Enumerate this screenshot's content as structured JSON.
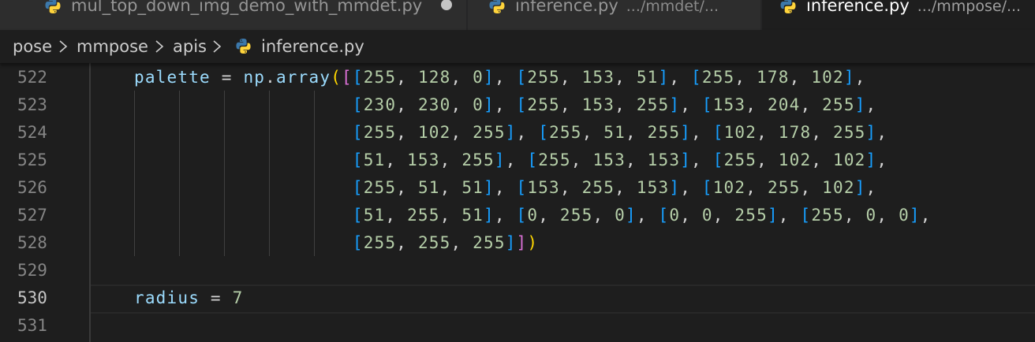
{
  "tabs": [
    {
      "label": "mul_top_down_img_demo_with_mmdet.py",
      "description": "",
      "modified": true,
      "active": false
    },
    {
      "label": "inference.py",
      "description": ".../mmdet/...",
      "modified": false,
      "active": false
    },
    {
      "label": "inference.py",
      "description": ".../mmpose/...",
      "modified": false,
      "active": true
    }
  ],
  "breadcrumb": {
    "items": [
      "pose",
      "mmpose",
      "apis",
      "inference.py"
    ],
    "file_icon": "python-file-icon"
  },
  "editor": {
    "active_line": "530",
    "lines": [
      {
        "number": "522",
        "tokens": [
          [
            "v",
            "palette"
          ],
          [
            "p",
            " = "
          ],
          [
            "v",
            "np"
          ],
          [
            "p",
            "."
          ],
          [
            "v",
            "array"
          ],
          [
            "b1",
            "("
          ],
          [
            "b2",
            "["
          ],
          [
            "b3",
            "["
          ],
          [
            "n",
            "255"
          ],
          [
            "p",
            ", "
          ],
          [
            "n",
            "128"
          ],
          [
            "p",
            ", "
          ],
          [
            "n",
            "0"
          ],
          [
            "b3",
            "]"
          ],
          [
            "p",
            ", "
          ],
          [
            "b3",
            "["
          ],
          [
            "n",
            "255"
          ],
          [
            "p",
            ", "
          ],
          [
            "n",
            "153"
          ],
          [
            "p",
            ", "
          ],
          [
            "n",
            "51"
          ],
          [
            "b3",
            "]"
          ],
          [
            "p",
            ", "
          ],
          [
            "b3",
            "["
          ],
          [
            "n",
            "255"
          ],
          [
            "p",
            ", "
          ],
          [
            "n",
            "178"
          ],
          [
            "p",
            ", "
          ],
          [
            "n",
            "102"
          ],
          [
            "b3",
            "]"
          ],
          [
            "p",
            ","
          ]
        ]
      },
      {
        "number": "523",
        "tokens": [
          [
            "p",
            "                    "
          ],
          [
            "b3",
            "["
          ],
          [
            "n",
            "230"
          ],
          [
            "p",
            ", "
          ],
          [
            "n",
            "230"
          ],
          [
            "p",
            ", "
          ],
          [
            "n",
            "0"
          ],
          [
            "b3",
            "]"
          ],
          [
            "p",
            ", "
          ],
          [
            "b3",
            "["
          ],
          [
            "n",
            "255"
          ],
          [
            "p",
            ", "
          ],
          [
            "n",
            "153"
          ],
          [
            "p",
            ", "
          ],
          [
            "n",
            "255"
          ],
          [
            "b3",
            "]"
          ],
          [
            "p",
            ", "
          ],
          [
            "b3",
            "["
          ],
          [
            "n",
            "153"
          ],
          [
            "p",
            ", "
          ],
          [
            "n",
            "204"
          ],
          [
            "p",
            ", "
          ],
          [
            "n",
            "255"
          ],
          [
            "b3",
            "]"
          ],
          [
            "p",
            ","
          ]
        ]
      },
      {
        "number": "524",
        "tokens": [
          [
            "p",
            "                    "
          ],
          [
            "b3",
            "["
          ],
          [
            "n",
            "255"
          ],
          [
            "p",
            ", "
          ],
          [
            "n",
            "102"
          ],
          [
            "p",
            ", "
          ],
          [
            "n",
            "255"
          ],
          [
            "b3",
            "]"
          ],
          [
            "p",
            ", "
          ],
          [
            "b3",
            "["
          ],
          [
            "n",
            "255"
          ],
          [
            "p",
            ", "
          ],
          [
            "n",
            "51"
          ],
          [
            "p",
            ", "
          ],
          [
            "n",
            "255"
          ],
          [
            "b3",
            "]"
          ],
          [
            "p",
            ", "
          ],
          [
            "b3",
            "["
          ],
          [
            "n",
            "102"
          ],
          [
            "p",
            ", "
          ],
          [
            "n",
            "178"
          ],
          [
            "p",
            ", "
          ],
          [
            "n",
            "255"
          ],
          [
            "b3",
            "]"
          ],
          [
            "p",
            ","
          ]
        ]
      },
      {
        "number": "525",
        "tokens": [
          [
            "p",
            "                    "
          ],
          [
            "b3",
            "["
          ],
          [
            "n",
            "51"
          ],
          [
            "p",
            ", "
          ],
          [
            "n",
            "153"
          ],
          [
            "p",
            ", "
          ],
          [
            "n",
            "255"
          ],
          [
            "b3",
            "]"
          ],
          [
            "p",
            ", "
          ],
          [
            "b3",
            "["
          ],
          [
            "n",
            "255"
          ],
          [
            "p",
            ", "
          ],
          [
            "n",
            "153"
          ],
          [
            "p",
            ", "
          ],
          [
            "n",
            "153"
          ],
          [
            "b3",
            "]"
          ],
          [
            "p",
            ", "
          ],
          [
            "b3",
            "["
          ],
          [
            "n",
            "255"
          ],
          [
            "p",
            ", "
          ],
          [
            "n",
            "102"
          ],
          [
            "p",
            ", "
          ],
          [
            "n",
            "102"
          ],
          [
            "b3",
            "]"
          ],
          [
            "p",
            ","
          ]
        ]
      },
      {
        "number": "526",
        "tokens": [
          [
            "p",
            "                    "
          ],
          [
            "b3",
            "["
          ],
          [
            "n",
            "255"
          ],
          [
            "p",
            ", "
          ],
          [
            "n",
            "51"
          ],
          [
            "p",
            ", "
          ],
          [
            "n",
            "51"
          ],
          [
            "b3",
            "]"
          ],
          [
            "p",
            ", "
          ],
          [
            "b3",
            "["
          ],
          [
            "n",
            "153"
          ],
          [
            "p",
            ", "
          ],
          [
            "n",
            "255"
          ],
          [
            "p",
            ", "
          ],
          [
            "n",
            "153"
          ],
          [
            "b3",
            "]"
          ],
          [
            "p",
            ", "
          ],
          [
            "b3",
            "["
          ],
          [
            "n",
            "102"
          ],
          [
            "p",
            ", "
          ],
          [
            "n",
            "255"
          ],
          [
            "p",
            ", "
          ],
          [
            "n",
            "102"
          ],
          [
            "b3",
            "]"
          ],
          [
            "p",
            ","
          ]
        ]
      },
      {
        "number": "527",
        "tokens": [
          [
            "p",
            "                    "
          ],
          [
            "b3",
            "["
          ],
          [
            "n",
            "51"
          ],
          [
            "p",
            ", "
          ],
          [
            "n",
            "255"
          ],
          [
            "p",
            ", "
          ],
          [
            "n",
            "51"
          ],
          [
            "b3",
            "]"
          ],
          [
            "p",
            ", "
          ],
          [
            "b3",
            "["
          ],
          [
            "n",
            "0"
          ],
          [
            "p",
            ", "
          ],
          [
            "n",
            "255"
          ],
          [
            "p",
            ", "
          ],
          [
            "n",
            "0"
          ],
          [
            "b3",
            "]"
          ],
          [
            "p",
            ", "
          ],
          [
            "b3",
            "["
          ],
          [
            "n",
            "0"
          ],
          [
            "p",
            ", "
          ],
          [
            "n",
            "0"
          ],
          [
            "p",
            ", "
          ],
          [
            "n",
            "255"
          ],
          [
            "b3",
            "]"
          ],
          [
            "p",
            ", "
          ],
          [
            "b3",
            "["
          ],
          [
            "n",
            "255"
          ],
          [
            "p",
            ", "
          ],
          [
            "n",
            "0"
          ],
          [
            "p",
            ", "
          ],
          [
            "n",
            "0"
          ],
          [
            "b3",
            "]"
          ],
          [
            "p",
            ","
          ]
        ]
      },
      {
        "number": "528",
        "tokens": [
          [
            "p",
            "                    "
          ],
          [
            "b3",
            "["
          ],
          [
            "n",
            "255"
          ],
          [
            "p",
            ", "
          ],
          [
            "n",
            "255"
          ],
          [
            "p",
            ", "
          ],
          [
            "n",
            "255"
          ],
          [
            "b3",
            "]"
          ],
          [
            "b2",
            "]"
          ],
          [
            "b1",
            ")"
          ]
        ]
      },
      {
        "number": "529",
        "tokens": []
      },
      {
        "number": "530",
        "tokens": [
          [
            "v",
            "radius"
          ],
          [
            "p",
            " = "
          ],
          [
            "n",
            "7"
          ]
        ]
      },
      {
        "number": "531",
        "tokens": []
      }
    ]
  },
  "colors": {
    "background": "#1e1e1e",
    "variable": "#9cdcfe",
    "number": "#b5cea8",
    "bracket_level1": "#ffd700",
    "bracket_level2": "#da70d6",
    "bracket_level3": "#179fff"
  }
}
